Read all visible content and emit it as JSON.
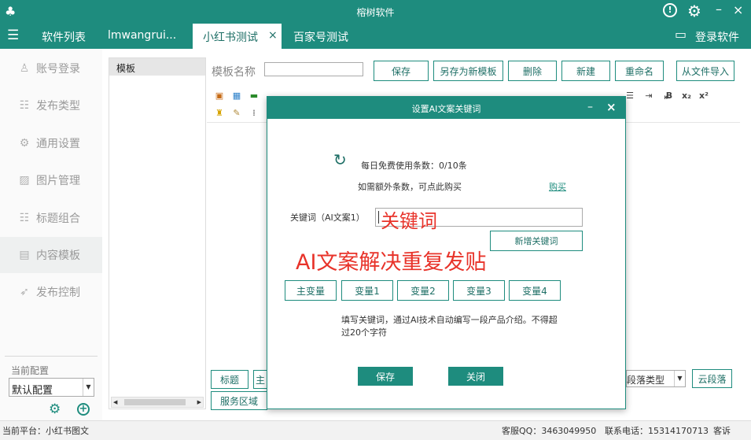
{
  "titlebar": {
    "title": "榕树软件"
  },
  "tabs": {
    "items": [
      {
        "label": "软件列表"
      },
      {
        "label": "lmwangrui..."
      },
      {
        "label": "小红书测试",
        "active": true
      },
      {
        "label": "百家号测试"
      }
    ],
    "login_label": "登录软件"
  },
  "sidebar": {
    "items": [
      {
        "label": "账号登录",
        "icon": "user-icon"
      },
      {
        "label": "发布类型",
        "icon": "list-icon"
      },
      {
        "label": "通用设置",
        "icon": "gear-icon"
      },
      {
        "label": "图片管理",
        "icon": "image-icon"
      },
      {
        "label": "标题组合",
        "icon": "list-icon"
      },
      {
        "label": "内容模板",
        "icon": "template-icon",
        "active": true
      },
      {
        "label": "发布控制",
        "icon": "send-icon"
      }
    ],
    "current_config_label": "当前配置",
    "config_select_value": "默认配置"
  },
  "template_list": {
    "header": "模板"
  },
  "editor": {
    "name_label": "模板名称",
    "name_value": "",
    "buttons": {
      "save": "保存",
      "save_as": "另存为新模板",
      "delete": "删除",
      "new": "新建",
      "rename": "重命名",
      "import": "从文件导入"
    },
    "bottom": {
      "title_btn": "标题",
      "main_btn": "主",
      "service_btn": "服务区域",
      "paragraph_type": "段落类型",
      "cloud_btn": "云段落"
    }
  },
  "dialog": {
    "title": "设置AI文案关键词",
    "usage_text": "每日免费使用条数：0/10条",
    "extra_text": "如需额外条数，可点此购买",
    "buy_link": "购买",
    "keyword_label": "关键词（AI文案1）",
    "keyword_value": "关键词",
    "add_keyword_btn": "新增关键词",
    "overlay_text": "AI文案解决重复发贴",
    "var_buttons": [
      "主变量",
      "变量1",
      "变量2",
      "变量3",
      "变量4"
    ],
    "hint": "填写关键词，通过AI技术自动编写一段产品介绍。不得超过20个字符",
    "save_btn": "保存",
    "close_btn": "关闭"
  },
  "statusbar": {
    "platform": "当前平台：小红书图文",
    "qq": "客服QQ：3463049950",
    "phone": "联系电话：15314170713",
    "complain": "客诉"
  },
  "colors": {
    "accent": "#1e8c7e",
    "overlay_red": "#e8332a"
  }
}
